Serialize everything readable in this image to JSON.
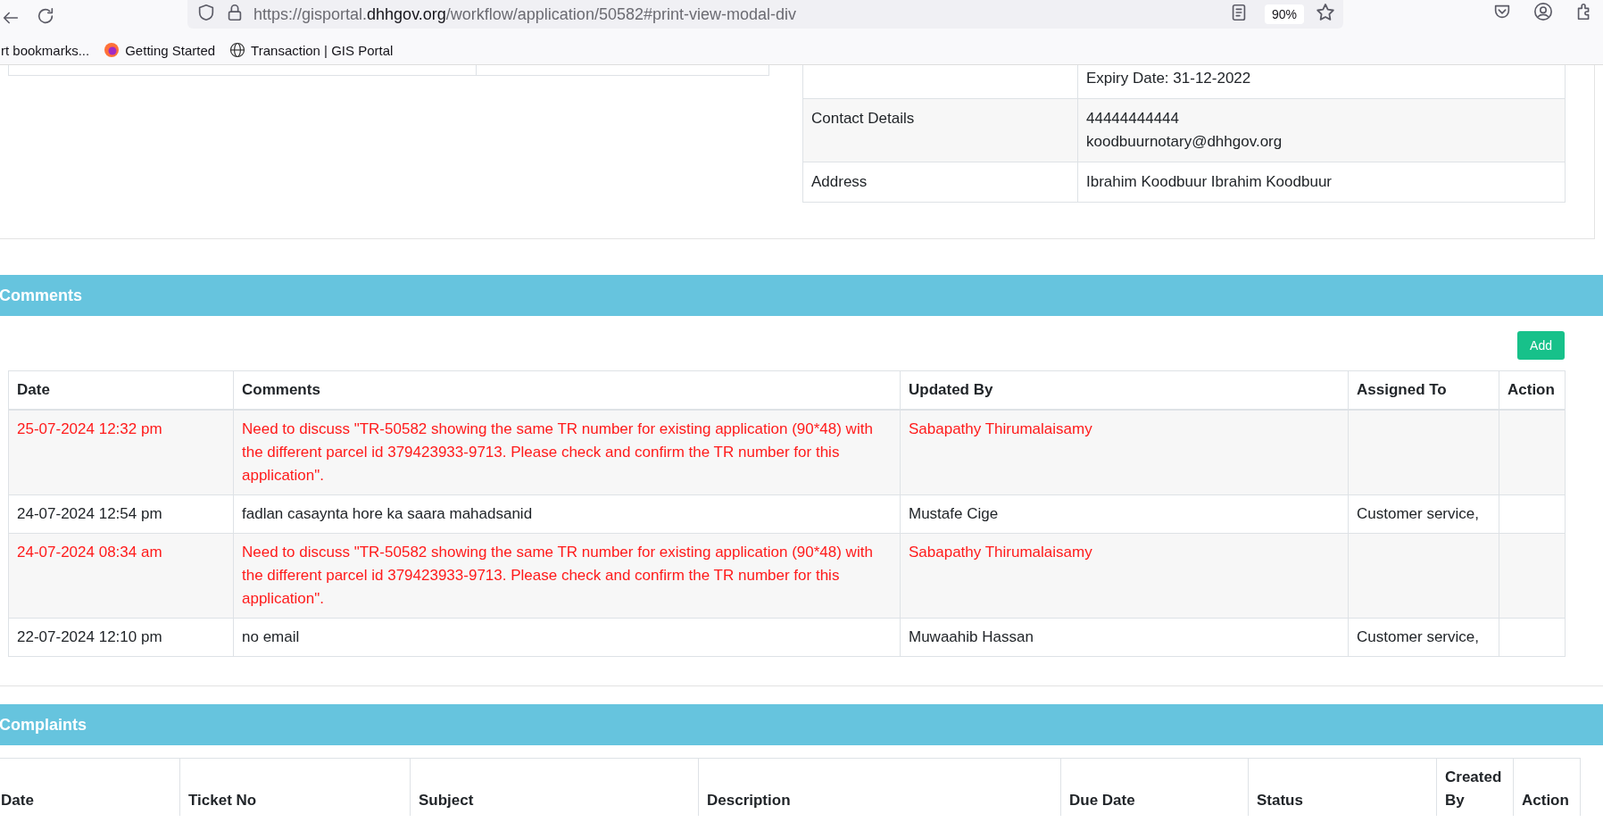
{
  "browser": {
    "url": {
      "prefix": "https://gisportal.",
      "domain": "dhhgov.org",
      "path": "/workflow/application/50582#print-view-modal-div"
    },
    "zoom": "90%",
    "bookmarks": [
      {
        "label": "rt bookmarks..."
      },
      {
        "label": "Getting Started"
      },
      {
        "label": "Transaction | GIS Portal"
      }
    ]
  },
  "details_table": {
    "rows": [
      {
        "label": "",
        "lines": [
          "Expiry Date: 31-12-2022"
        ]
      },
      {
        "label": "Contact Details",
        "lines": [
          "44444444444",
          "koodbuurnotary@dhhgov.org"
        ]
      },
      {
        "label": "Address",
        "lines": [
          "Ibrahim Koodbuur Ibrahim Koodbuur"
        ]
      }
    ]
  },
  "comments": {
    "title": "Comments",
    "add_button": "Add",
    "columns": [
      "Date",
      "Comments",
      "Updated By",
      "Assigned To",
      "Action"
    ],
    "rows": [
      {
        "flagged": true,
        "date": "25-07-2024 12:32 pm",
        "comment": "Need to discuss \"TR-50582 showing the same TR number for existing application (90*48) with the different parcel id 379423933-9713. Please check and confirm the TR number for this application\".",
        "updated_by": "Sabapathy Thirumalaisamy",
        "assigned_to": ""
      },
      {
        "flagged": false,
        "date": "24-07-2024 12:54 pm",
        "comment": "fadlan casaynta hore ka saara mahadsanid",
        "updated_by": "Mustafe Cige",
        "assigned_to": "Customer service,"
      },
      {
        "flagged": true,
        "date": "24-07-2024 08:34 am",
        "comment": "Need to discuss \"TR-50582 showing the same TR number for existing application (90*48) with the different parcel id 379423933-9713. Please check and confirm the TR number for this application\".",
        "updated_by": "Sabapathy Thirumalaisamy",
        "assigned_to": ""
      },
      {
        "flagged": false,
        "date": "22-07-2024 12:10 pm",
        "comment": "no email",
        "updated_by": "Muwaahib Hassan",
        "assigned_to": "Customer service,"
      }
    ]
  },
  "complaints": {
    "title": "Complaints",
    "columns": [
      "Date",
      "Ticket No",
      "Subject",
      "Description",
      "Due Date",
      "Status",
      "Created By",
      "Action"
    ]
  }
}
